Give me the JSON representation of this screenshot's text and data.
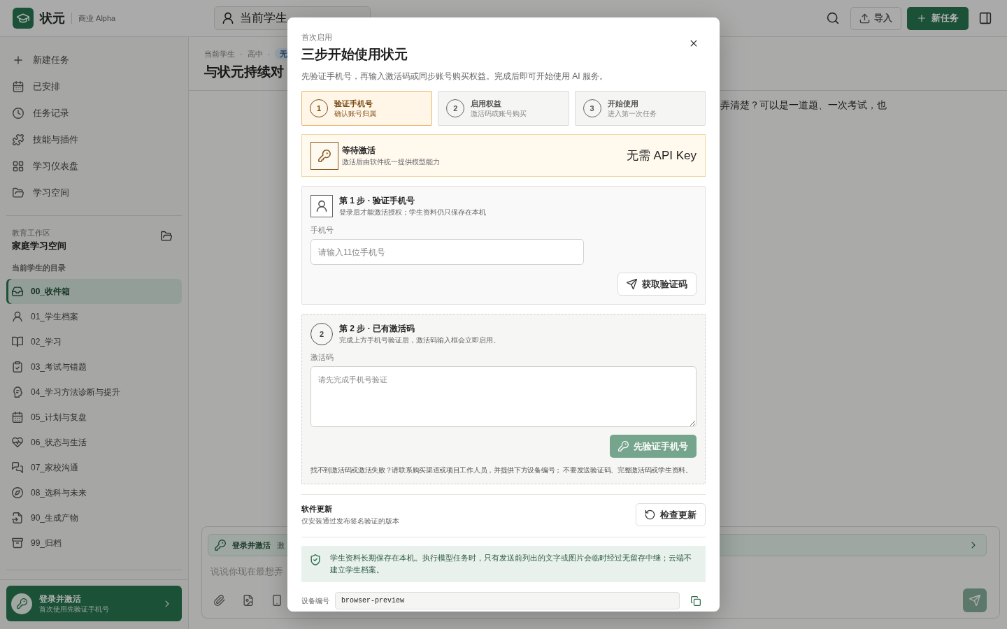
{
  "top_bar": {
    "app_name": "状元",
    "edition": "商业 Alpha",
    "student_selector": "当前学生",
    "import_button": "导入",
    "new_task_button": "新任务"
  },
  "sidebar": {
    "nav_items": [
      "新建任务",
      "已安排",
      "任务记录",
      "技能与插件",
      "学习仪表盘",
      "学习空间"
    ],
    "workspace": {
      "caption": "教育工作区",
      "name": "家庭学习空间"
    },
    "folders_heading": "当前学生的目录",
    "folders": [
      {
        "label": "00_收件箱",
        "selected": true
      },
      {
        "label": "01_学生档案",
        "selected": false
      },
      {
        "label": "02_学习",
        "selected": false
      },
      {
        "label": "03_考试与错题",
        "selected": false
      },
      {
        "label": "04_学习方法诊断与提升",
        "selected": false
      },
      {
        "label": "05_计划与复盘",
        "selected": false
      },
      {
        "label": "06_状态与生活",
        "selected": false
      },
      {
        "label": "07_家校沟通",
        "selected": false
      },
      {
        "label": "08_选科与未来",
        "selected": false
      },
      {
        "label": "90_生成产物",
        "selected": false
      },
      {
        "label": "99_归档",
        "selected": false
      }
    ],
    "activation_card": {
      "title": "登录并激活",
      "subtitle": "首次使用先验证手机号"
    }
  },
  "main": {
    "breadcrumb": {
      "items": [
        "当前学生",
        "高中"
      ],
      "separator": "·",
      "badge": "无"
    },
    "title": "与状元持续对",
    "message_fragment": "弄清楚？可以是一道题、一次考试，也",
    "composer": {
      "banner_title": "登录并激活",
      "banner_text": "激",
      "placeholder": "说说你现在最想弄",
      "send_button": {
        "disabled": true
      }
    }
  },
  "dialog": {
    "eyebrow": "首次启用",
    "title": "三步开始使用状元",
    "description": "先验证手机号，再输入激活码或同步账号购买权益。完成后即可开始使用 AI 服务。",
    "steps": [
      {
        "number": "1",
        "title": "验证手机号",
        "subtitle": "确认账号归属",
        "selected": true
      },
      {
        "number": "2",
        "title": "启用权益",
        "subtitle": "激活码或账号购买",
        "selected": false
      },
      {
        "number": "3",
        "title": "开始使用",
        "subtitle": "进入第一次任务",
        "selected": false
      }
    ],
    "status": {
      "title": "等待激活",
      "subtitle": "激活后由软件统一提供模型能力",
      "note": "无需 API Key"
    },
    "phone_step": {
      "title": "第 1 步 · 验证手机号",
      "subtitle": "登录后才能激活授权；学生资料仍只保存在本机",
      "label": "手机号",
      "placeholder": "请输入11位手机号",
      "button": "获取验证码"
    },
    "code_step": {
      "number": "2",
      "title": "第 2 步 · 已有激活码",
      "subtitle": "完成上方手机号验证后，激活码输入框会立即启用。",
      "label": "激活码",
      "placeholder": "请先完成手机号验证",
      "button": {
        "label": "先验证手机号",
        "disabled": true
      },
      "help": "找不到激活码或激活失败？请联系购买渠道或项目工作人员，并提供下方设备编号； 不要发送验证码、完整激活码或学生资料。"
    },
    "update": {
      "title": "软件更新",
      "subtitle": "仅安装通过发布签名验证的版本",
      "button": "检查更新"
    },
    "privacy_note": "学生资料长期保存在本机。执行模型任务时，只有发送前列出的文字或图片会临时经过无留存中继；云端不建立学生档案。",
    "device": {
      "label": "设备编号",
      "value": "browser-preview"
    }
  }
}
